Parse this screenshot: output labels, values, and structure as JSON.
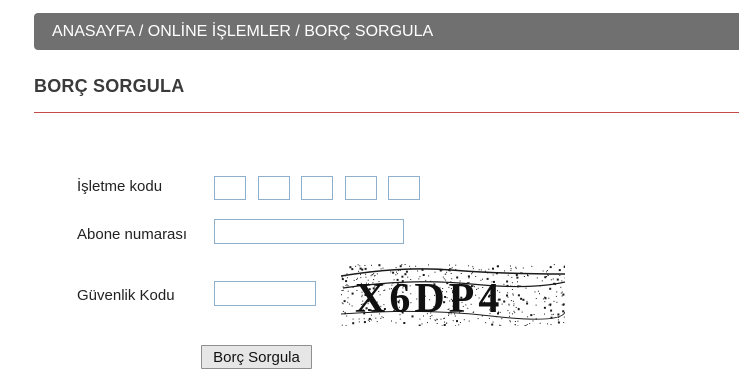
{
  "breadcrumb": "ANASAYFA / ONLİNE İŞLEMLER / BORÇ SORGULA",
  "page_title": "BORÇ SORGULA",
  "form": {
    "isletme_label": "İşletme kodu",
    "isletme_boxes": [
      "",
      "",
      "",
      "",
      ""
    ],
    "abone_label": "Abone numarası",
    "abone_value": "",
    "guvenlik_label": "Güvenlik Kodu",
    "guvenlik_value": "",
    "captcha_text": "X6DP4",
    "submit_label": "Borç Sorgula"
  },
  "colors": {
    "breadcrumb_bg": "#707070",
    "title_rule": "#c54a4a",
    "input_border": "#8fb0cc"
  }
}
